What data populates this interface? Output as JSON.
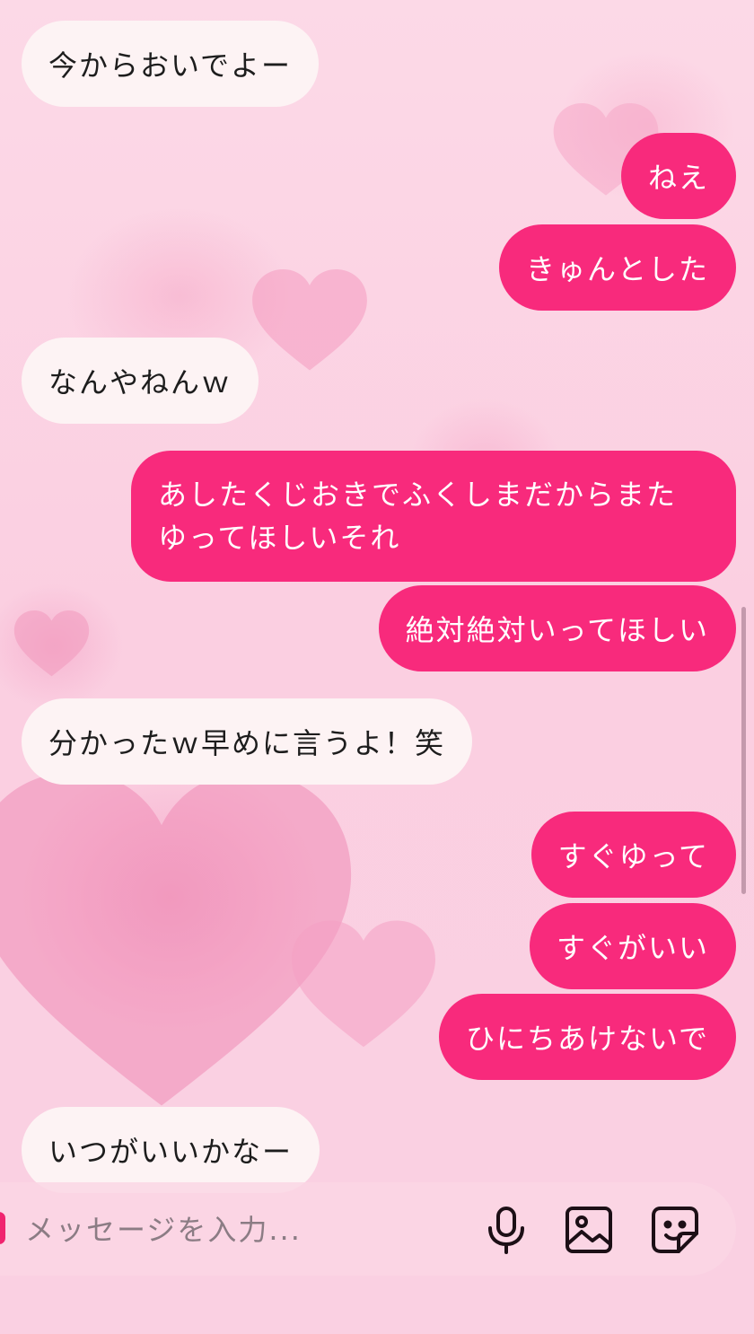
{
  "messages": [
    {
      "side": "in",
      "text": "今からおいでよー"
    },
    {
      "side": "out",
      "text": "ねえ"
    },
    {
      "side": "out",
      "text": "きゅんとした"
    },
    {
      "side": "in",
      "text": "なんやねんｗ"
    },
    {
      "side": "out",
      "text": "あしたくじおきでふくしまだからまた"
    },
    {
      "side": "out",
      "text": "ゆってほしいそれ"
    },
    {
      "side": "out",
      "text": "絶対絶対いってほしい"
    },
    {
      "side": "in",
      "text": "分かったｗ早めに言うよ！笑"
    },
    {
      "side": "out",
      "text": "すぐゆって"
    },
    {
      "side": "out",
      "text": "すぐがいい"
    },
    {
      "side": "out",
      "text": "ひにちあけないで"
    },
    {
      "side": "in",
      "text": "いつがいいかなー"
    }
  ],
  "input": {
    "placeholder": "メッセージを入力..."
  },
  "icons": {
    "mic": "microphone-icon",
    "image": "image-icon",
    "sticker": "sticker-icon"
  },
  "colors": {
    "outgoing_bubble": "#f82a7c",
    "incoming_bubble": "#fdf3f4",
    "background": "#fbd3e3"
  }
}
